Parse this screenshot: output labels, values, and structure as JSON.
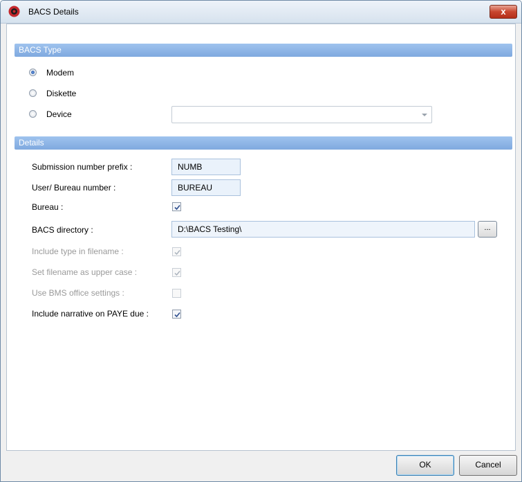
{
  "window": {
    "title": "BACS Details",
    "close_label": "x"
  },
  "bacs_type": {
    "header": "BACS Type",
    "options": [
      {
        "label": "Modem",
        "selected": true
      },
      {
        "label": "Diskette",
        "selected": false
      },
      {
        "label": "Device",
        "selected": false
      }
    ],
    "device_value": ""
  },
  "details": {
    "header": "Details",
    "submission_prefix": {
      "label": "Submission number prefix :",
      "value": "NUMB"
    },
    "bureau_number": {
      "label": "User/ Bureau number :",
      "value": "BUREAU"
    },
    "bureau": {
      "label": "Bureau :",
      "checked": true
    },
    "bacs_directory": {
      "label": "BACS directory :",
      "value": "D:\\BACS Testing\\",
      "browse_label": "..."
    },
    "include_type": {
      "label": "Include type in filename :",
      "checked": true,
      "enabled": false
    },
    "upper_case": {
      "label": "Set filename as upper case :",
      "checked": true,
      "enabled": false
    },
    "bms_office": {
      "label": "Use BMS office settings :",
      "checked": false,
      "enabled": false
    },
    "paye_narrative": {
      "label": "Include narrative on PAYE due :",
      "checked": true
    }
  },
  "buttons": {
    "ok": "OK",
    "cancel": "Cancel"
  }
}
